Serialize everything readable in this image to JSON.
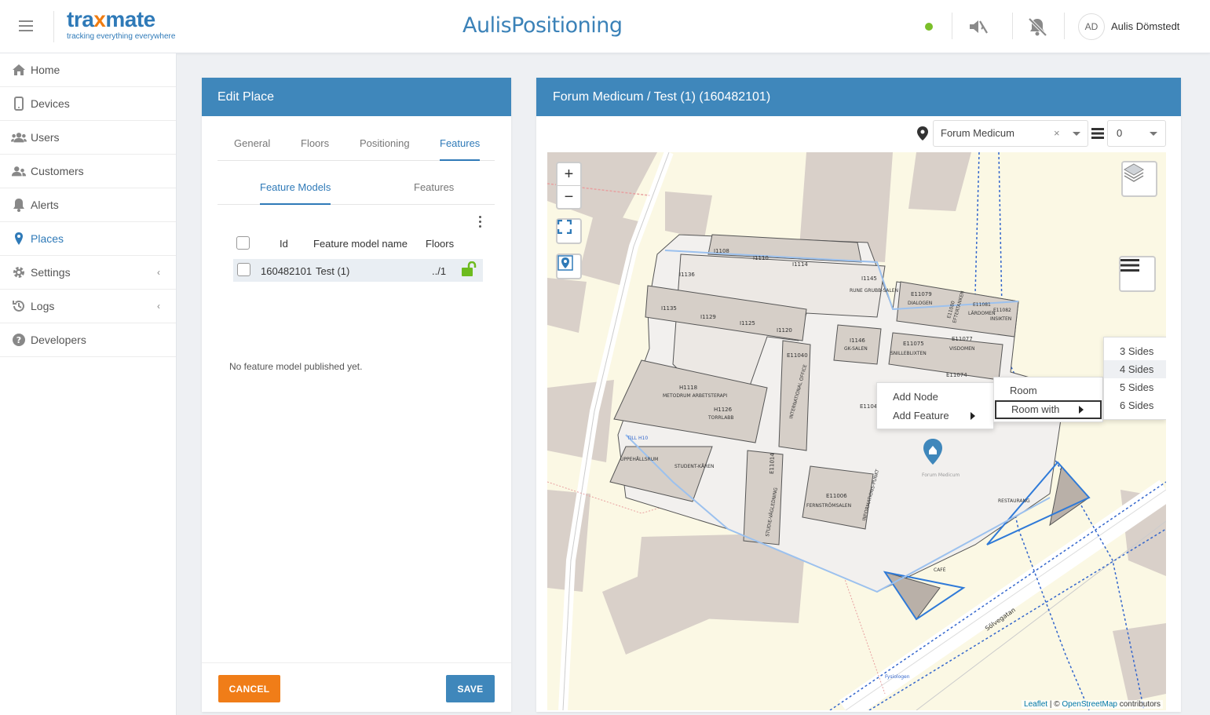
{
  "topbar": {
    "logo_main_a": "tra",
    "logo_main_x": "x",
    "logo_main_b": "mate",
    "logo_tagline": "tracking everything everywhere",
    "app_title": "AulisPositioning",
    "status_color": "#7bbf2a",
    "user_initials": "AD",
    "user_name": "Aulis Dömstedt",
    "icons": [
      "menu-icon",
      "sound-muted-icon",
      "notifications-off-icon"
    ]
  },
  "sidebar": {
    "items": [
      {
        "label": "Home",
        "icon": "home-icon"
      },
      {
        "label": "Devices",
        "icon": "device-icon"
      },
      {
        "label": "Users",
        "icon": "users-icon"
      },
      {
        "label": "Customers",
        "icon": "customers-icon"
      },
      {
        "label": "Alerts",
        "icon": "bell-icon"
      },
      {
        "label": "Places",
        "icon": "map-marker-icon",
        "active": true
      },
      {
        "label": "Settings",
        "icon": "gear-icon",
        "expandable": true
      },
      {
        "label": "Logs",
        "icon": "history-icon",
        "expandable": true
      },
      {
        "label": "Developers",
        "icon": "help-icon"
      }
    ]
  },
  "edit_panel": {
    "title": "Edit Place",
    "tabs": [
      "General",
      "Floors",
      "Positioning",
      "Features"
    ],
    "active_tab": "Features",
    "subtabs": [
      "Feature Models",
      "Features"
    ],
    "active_subtab": "Feature Models",
    "table": {
      "columns": [
        "Id",
        "Feature model name",
        "Floors"
      ],
      "rows": [
        {
          "id": "160482101",
          "name": "Test (1)",
          "floors": "../1",
          "locked": false
        }
      ]
    },
    "empty_note": "No feature model published yet.",
    "cancel_label": "CANCEL",
    "save_label": "SAVE"
  },
  "map_panel": {
    "title": "Forum Medicum / Test (1) (160482101)",
    "place_select": "Forum Medicum",
    "clear_symbol": "×",
    "floor_select": "0",
    "zoom_in": "+",
    "zoom_out": "−",
    "labels": {
      "rooms": [
        "I1108",
        "I1110",
        "I1114",
        "I1145",
        "RUNE GRUBB-SALEN",
        "I1136",
        "I1135",
        "I1129",
        "I1125",
        "I1120",
        "I1146",
        "GK-SALEN",
        "E11079",
        "DIALOGEN",
        "E11080",
        "EFTERTANKEN",
        "E11081",
        "LÄRDOMEN",
        "E11082",
        "INSIKTEN",
        "E11075",
        "SNILLEBLIXTEN",
        "E11077",
        "VISDOMEN",
        "E11074",
        "E11040",
        "INTERNATIONAL OFFICE",
        "E1104",
        "H1118",
        "METODRUM ARBETSTERAPI",
        "H1126",
        "TORRLABB",
        "TILL H10",
        "UPPEHÅLLSRUM",
        "STUDENT-KÅREN",
        "E11014",
        "STUDIE-VÄGLEDNING",
        "E11006",
        "FERNSTRÖMSALEN",
        "INFORMATIONS-PUNKT",
        "RESTAURANG",
        "CAFÉ",
        "Forum Medicum",
        "Sölvegatan",
        "Fysiologen"
      ]
    },
    "attribution": {
      "leaflet": "Leaflet",
      "sep": " | © ",
      "osm": "OpenStreetMap",
      "suffix": " contributors"
    },
    "context_menu": {
      "items": [
        "Add Node",
        "Add Feature"
      ]
    },
    "submenu": {
      "items": [
        "Room",
        "Room with"
      ]
    },
    "sides_menu": {
      "items": [
        "3 Sides",
        "4 Sides",
        "5 Sides",
        "6 Sides"
      ],
      "hovered": "4 Sides"
    }
  },
  "colors": {
    "primary": "#3f87bb",
    "accent": "#f07d18",
    "unlock": "#6dbb1e",
    "map_bg": "#fbf8e4",
    "building": "#d9d0c9"
  }
}
